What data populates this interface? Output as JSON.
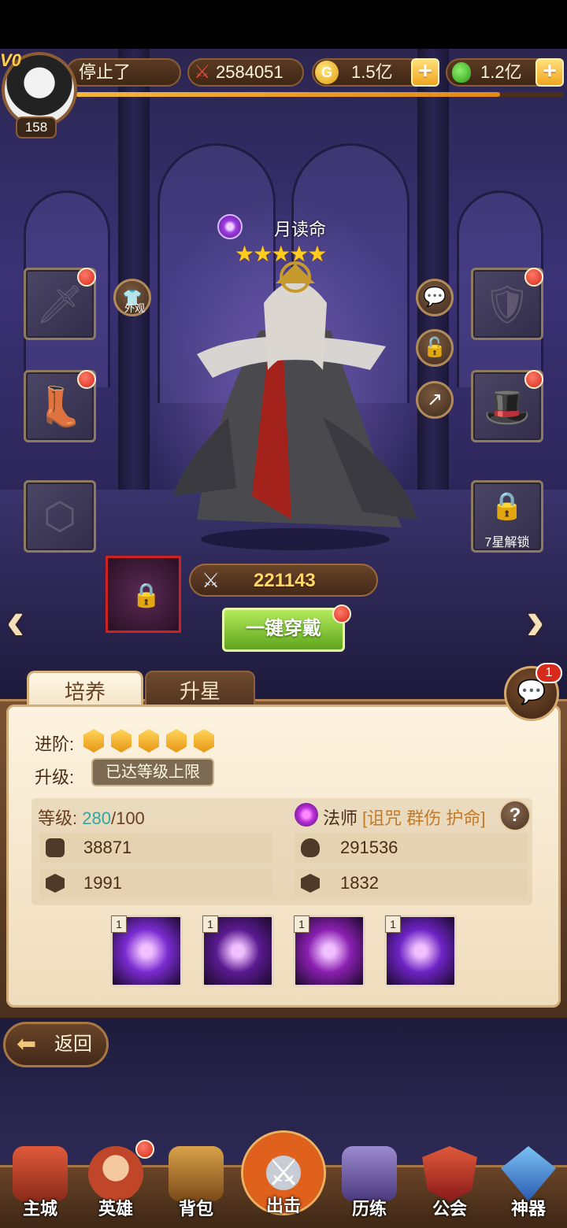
{
  "topbar": {
    "vip": "V0",
    "player_name": "停止了",
    "power": "2584051",
    "gold": "1.5亿",
    "potion": "1.2亿",
    "player_level": "158",
    "exp_progress": 0.87
  },
  "hero": {
    "name": "月读命",
    "stars": "★★★★★",
    "star_count": 5,
    "combat_power": "221143",
    "equip_all_label": "一键穿戴",
    "outfit_label": "外观",
    "unlock_7star_label": "7星解锁"
  },
  "tabs": {
    "train": "培养",
    "star_up": "升星"
  },
  "panel": {
    "advance_label": "进阶:",
    "advance_gems": 5,
    "upgrade_label": "升级:",
    "max_level_text": "已达等级上限",
    "level_label": "等级:",
    "level_current": "280",
    "level_max": "/100",
    "class_text": "法师",
    "class_tags": "[诅咒 群伤 护命]",
    "help": "?",
    "stats": {
      "attack": "38871",
      "hp": "291536",
      "defense": "1991",
      "speed": "1832"
    },
    "skills": [
      {
        "level": "1",
        "color": "#7a2bd1"
      },
      {
        "level": "1",
        "color": "#5a1a90"
      },
      {
        "level": "1",
        "color": "#8a1fb0"
      },
      {
        "level": "1",
        "color": "#6d23c4"
      }
    ]
  },
  "chat": {
    "badge": "1"
  },
  "back_label": "返回",
  "nav": [
    {
      "label": "主城",
      "color": "#c0392b"
    },
    {
      "label": "英雄",
      "color": "#d35d2a"
    },
    {
      "label": "背包",
      "color": "#b8862e"
    },
    {
      "label": "出击",
      "color": "#9aa0a8"
    },
    {
      "label": "历练",
      "color": "#6e5a9c"
    },
    {
      "label": "公会",
      "color": "#c0392b"
    },
    {
      "label": "神器",
      "color": "#3a7fd0"
    }
  ]
}
